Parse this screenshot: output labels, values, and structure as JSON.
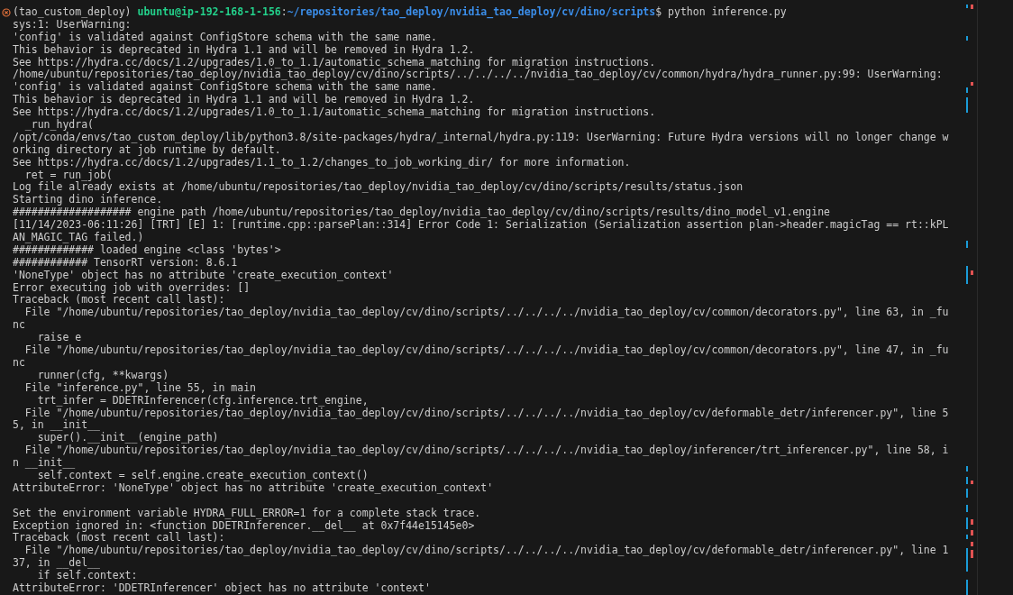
{
  "prompt": {
    "failed": true,
    "env": "(tao_custom_deploy)",
    "user_host": "ubuntu@ip-192-168-1-156",
    "separator": ":",
    "path": "~/repositories/tao_deploy/nvidia_tao_deploy/cv/dino/scripts",
    "symbol": "$",
    "command": "python inference.py"
  },
  "output_blocks": [
    [
      "sys:1: UserWarning:",
      "'config' is validated against ConfigStore schema with the same name.",
      "This behavior is deprecated in Hydra 1.1 and will be removed in Hydra 1.2.",
      "See https://hydra.cc/docs/1.2/upgrades/1.0_to_1.1/automatic_schema_matching for migration instructions.",
      "/home/ubuntu/repositories/tao_deploy/nvidia_tao_deploy/cv/dino/scripts/../../../../nvidia_tao_deploy/cv/common/hydra/hydra_runner.py:99: UserWarning:",
      "'config' is validated against ConfigStore schema with the same name.",
      "This behavior is deprecated in Hydra 1.1 and will be removed in Hydra 1.2.",
      "See https://hydra.cc/docs/1.2/upgrades/1.0_to_1.1/automatic_schema_matching for migration instructions.",
      "  _run_hydra(",
      "/opt/conda/envs/tao_custom_deploy/lib/python3.8/site-packages/hydra/_internal/hydra.py:119: UserWarning: Future Hydra versions will no longer change w",
      "orking directory at job runtime by default.",
      "See https://hydra.cc/docs/1.2/upgrades/1.1_to_1.2/changes_to_job_working_dir/ for more information.",
      "  ret = run_job(",
      "Log file already exists at /home/ubuntu/repositories/tao_deploy/nvidia_tao_deploy/cv/dino/scripts/results/status.json",
      "Starting dino inference.",
      "################### engine path /home/ubuntu/repositories/tao_deploy/nvidia_tao_deploy/cv/dino/scripts/results/dino_model_v1.engine",
      "[11/14/2023-06:11:26] [TRT] [E] 1: [runtime.cpp::parsePlan::314] Error Code 1: Serialization (Serialization assertion plan->header.magicTag == rt::kPL",
      "AN_MAGIC_TAG failed.)",
      "############# loaded engine <class 'bytes'>",
      "############ TensorRT version: 8.6.1",
      "'NoneType' object has no attribute 'create_execution_context'",
      "Error executing job with overrides: []",
      "Traceback (most recent call last):",
      "  File \"/home/ubuntu/repositories/tao_deploy/nvidia_tao_deploy/cv/dino/scripts/../../../../nvidia_tao_deploy/cv/common/decorators.py\", line 63, in _fu",
      "nc",
      "    raise e",
      "  File \"/home/ubuntu/repositories/tao_deploy/nvidia_tao_deploy/cv/dino/scripts/../../../../nvidia_tao_deploy/cv/common/decorators.py\", line 47, in _fu",
      "nc",
      "    runner(cfg, **kwargs)",
      "  File \"inference.py\", line 55, in main",
      "    trt_infer = DDETRInferencer(cfg.inference.trt_engine,",
      "  File \"/home/ubuntu/repositories/tao_deploy/nvidia_tao_deploy/cv/dino/scripts/../../../../nvidia_tao_deploy/cv/deformable_detr/inferencer.py\", line 5",
      "5, in __init__",
      "    super().__init__(engine_path)",
      "  File \"/home/ubuntu/repositories/tao_deploy/nvidia_tao_deploy/cv/dino/scripts/../../../../nvidia_tao_deploy/inferencer/trt_inferencer.py\", line 58, i",
      "n __init__",
      "    self.context = self.engine.create_execution_context()",
      "AttributeError: 'NoneType' object has no attribute 'create_execution_context'"
    ],
    [
      "Set the environment variable HYDRA_FULL_ERROR=1 for a complete stack trace.",
      "Exception ignored in: <function DDETRInferencer.__del__ at 0x7f44e15145e0>",
      "Traceback (most recent call last):",
      "  File \"/home/ubuntu/repositories/tao_deploy/nvidia_tao_deploy/cv/dino/scripts/../../../../nvidia_tao_deploy/cv/deformable_detr/inferencer.py\", line 1",
      "37, in __del__",
      "    if self.context:",
      "AttributeError: 'DDETRInferencer' object has no attribute 'context'"
    ]
  ]
}
